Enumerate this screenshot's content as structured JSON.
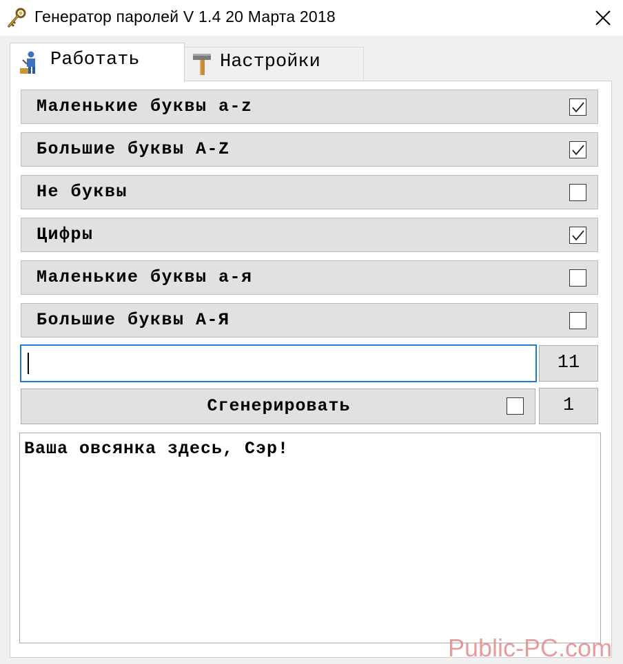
{
  "window": {
    "title": "Генератор паролей  V 1.4   20  Марта  2018",
    "icon": "key-icon",
    "close_icon": "close-icon"
  },
  "tabs": [
    {
      "label": "Работать",
      "icon": "worker-icon",
      "active": true
    },
    {
      "label": "Настройки",
      "icon": "hammer-icon",
      "active": false
    }
  ],
  "options": [
    {
      "label": "Маленькие буквы a-z",
      "checked": true
    },
    {
      "label": "Большие буквы A-Z",
      "checked": true
    },
    {
      "label": "Не буквы",
      "checked": false
    },
    {
      "label": "Цифры",
      "checked": true
    },
    {
      "label": "Маленькие буквы а-я",
      "checked": false
    },
    {
      "label": "Большие буквы А-Я",
      "checked": false
    }
  ],
  "password_field": {
    "value": ""
  },
  "length_value": "11",
  "generate": {
    "label": "Сгенерировать",
    "checked": false,
    "count_value": "1"
  },
  "output": {
    "text": "Ваша овсянка здесь, Сэр!"
  },
  "watermark": "Public-PC.com",
  "colors": {
    "focus_border": "#1e7bd2",
    "button_face": "#e1e1e1",
    "watermark": "#e58a8a"
  }
}
